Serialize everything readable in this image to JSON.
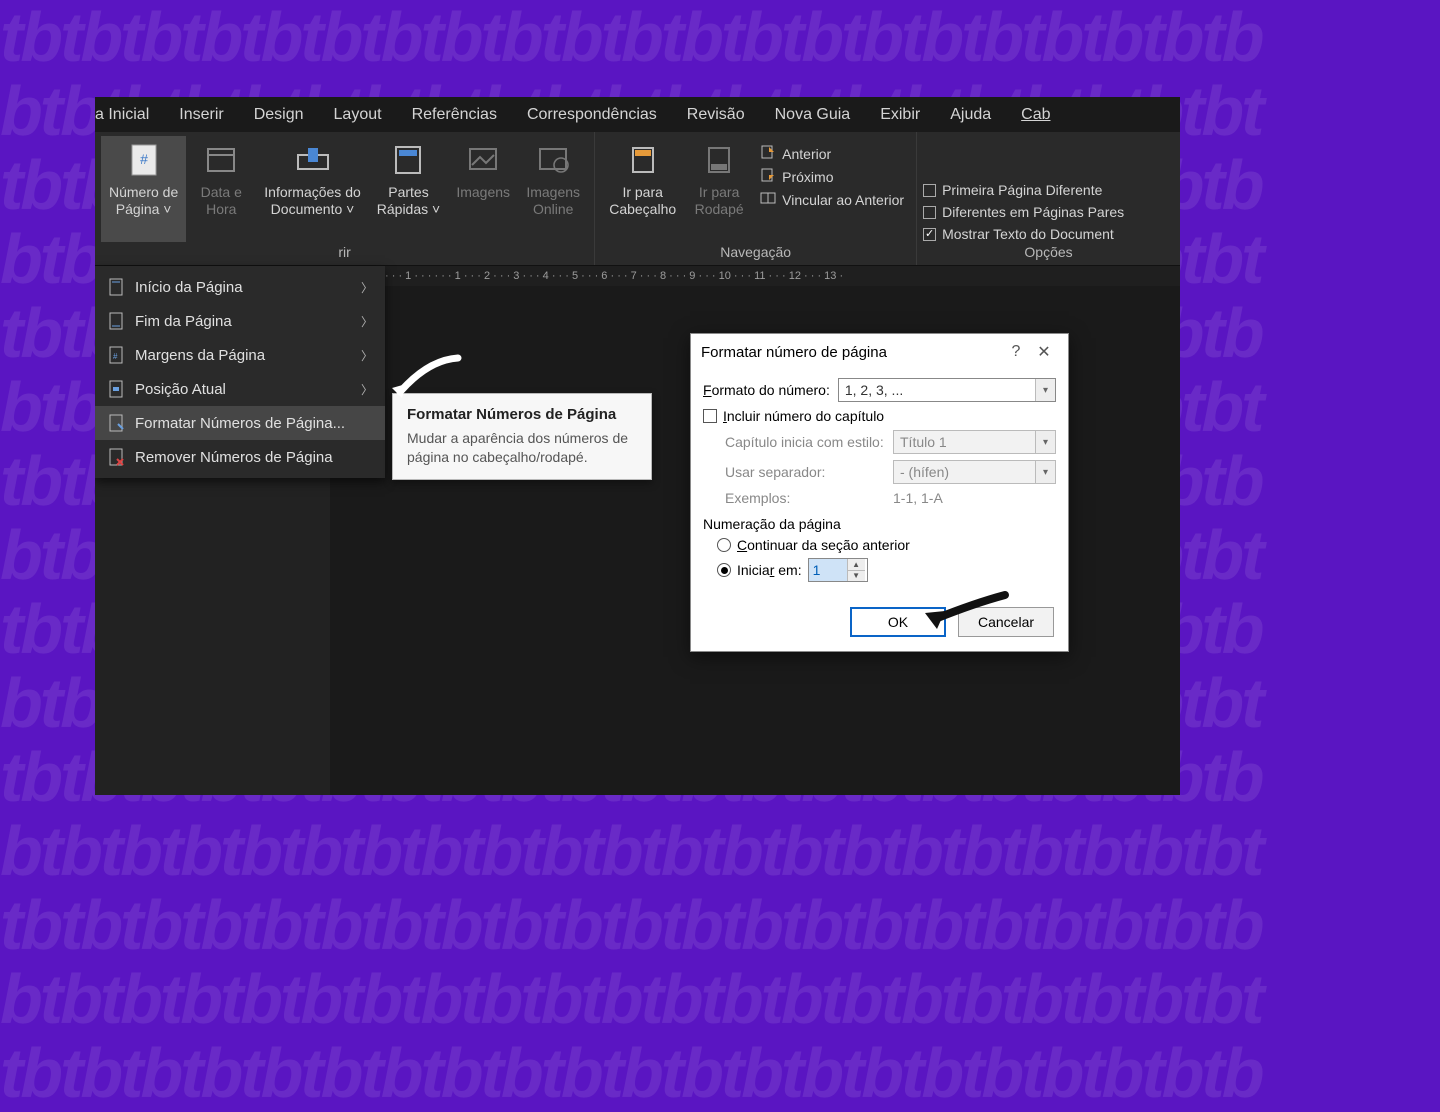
{
  "ribbon": {
    "tabs": [
      "a Inicial",
      "Inserir",
      "Design",
      "Layout",
      "Referências",
      "Correspondências",
      "Revisão",
      "Nova Guia",
      "Exibir",
      "Ajuda",
      "Cab"
    ],
    "buttons": {
      "pagenum": {
        "line1": "Número de",
        "line2": "Página ˅"
      },
      "datetime": {
        "line1": "Data e",
        "line2": "Hora"
      },
      "docinfo": {
        "line1": "Informações do",
        "line2": "Documento ˅"
      },
      "quickparts": {
        "line1": "Partes",
        "line2": "Rápidas ˅"
      },
      "images": {
        "line1": "Imagens",
        "line2": ""
      },
      "onlineimg": {
        "line1": "Imagens",
        "line2": "Online"
      },
      "gotohdr": {
        "line1": "Ir para",
        "line2": "Cabeçalho"
      },
      "gotoftr": {
        "line1": "Ir para",
        "line2": "Rodapé"
      }
    },
    "navLinks": {
      "prev": "Anterior",
      "next": "Próximo",
      "link": "Vincular ao Anterior"
    },
    "options": {
      "diffFirst": "Primeira Página Diferente",
      "diffEven": "Diferentes em Páginas Pares",
      "showText": "Mostrar Texto do Document"
    },
    "groupLabels": {
      "insert": "rir",
      "nav": "Navegação",
      "options": "Opções"
    }
  },
  "dropdown": {
    "items": [
      "Início da Página",
      "Fim da Página",
      "Margens da Página",
      "Posição Atual",
      "Formatar Números de Página...",
      "Remover Números de Página"
    ]
  },
  "tooltip": {
    "title": "Formatar Números de Página",
    "body": "Mudar a aparência dos números de página no cabeçalho/rodapé."
  },
  "ruler": "· · · 1 · · ·   · · · 1 · · · 2 · · · 3 · · · 4 · · · 5 · · · 6 · · · 7 · · · 8 · · · 9 · · · 10 · · · 11 · · · 12 · · · 13 ·",
  "dialog": {
    "title": "Formatar número de página",
    "numberFormatLabel": "Formato do número:",
    "numberFormatValue": "1, 2, 3, ...",
    "includeChapter": "Incluir número do capítulo",
    "chapterStyleLabel": "Capítulo inicia com estilo:",
    "chapterStyleValue": "Título 1",
    "sepLabel": "Usar separador:",
    "sepValue": "-   (hífen)",
    "examplesLabel": "Exemplos:",
    "examplesValue": "1-1, 1-A",
    "pagingTitle": "Numeração da página",
    "continueLabel": "Continuar da seção anterior",
    "startAtLabel": "Iniciar em:",
    "startAtValue": "1",
    "ok": "OK",
    "cancel": "Cancelar"
  }
}
